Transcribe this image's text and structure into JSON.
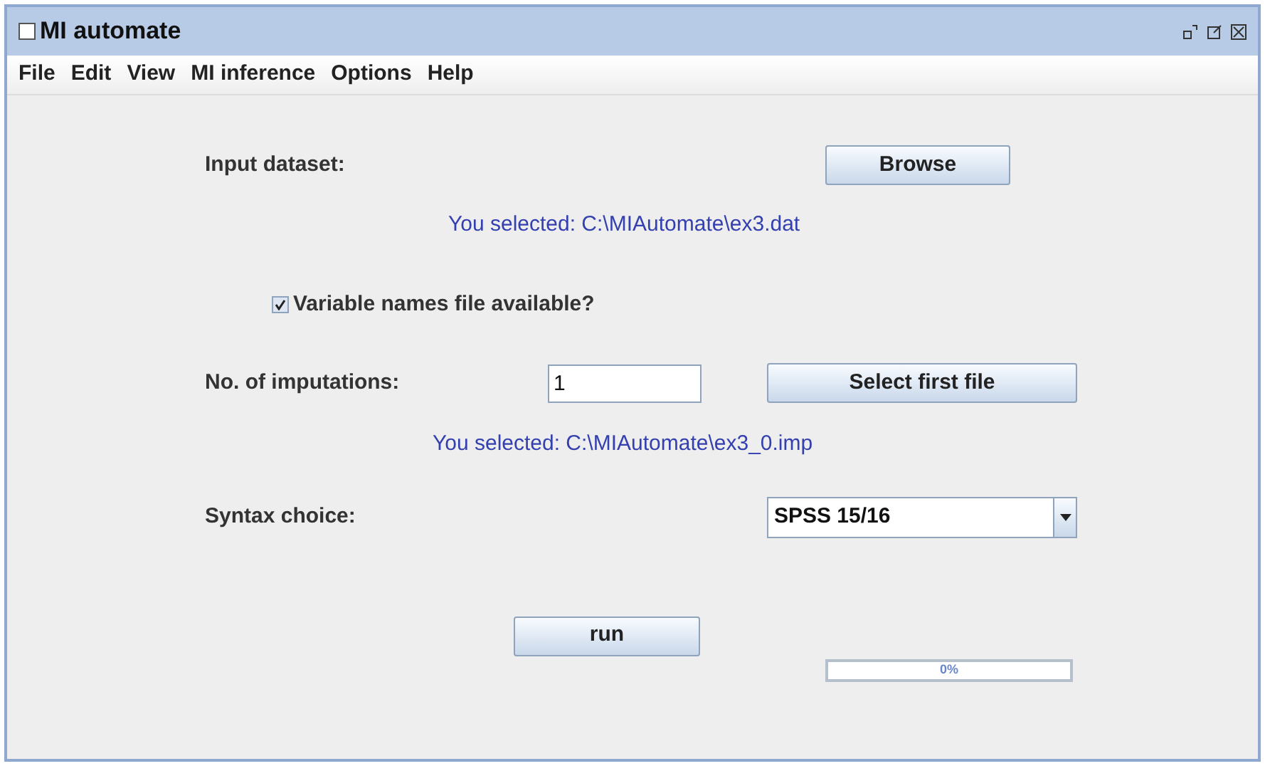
{
  "window": {
    "title": "MI automate"
  },
  "menu": [
    "File",
    "Edit",
    "View",
    "MI inference",
    "Options",
    "Help"
  ],
  "input_dataset": {
    "label": "Input dataset:",
    "button": "Browse",
    "selection": "You selected: C:\\MIAutomate\\ex3.dat"
  },
  "variable_names": {
    "label": "Variable names file available?",
    "checked": true
  },
  "imputations": {
    "label": "No. of imputations:",
    "value": "1",
    "button": "Select first file",
    "selection": "You selected: C:\\MIAutomate\\ex3_0.imp"
  },
  "syntax": {
    "label": "Syntax choice:",
    "value": "SPSS 15/16"
  },
  "run": {
    "button": "run"
  },
  "progress": {
    "level": 0,
    "reading": "0%"
  }
}
